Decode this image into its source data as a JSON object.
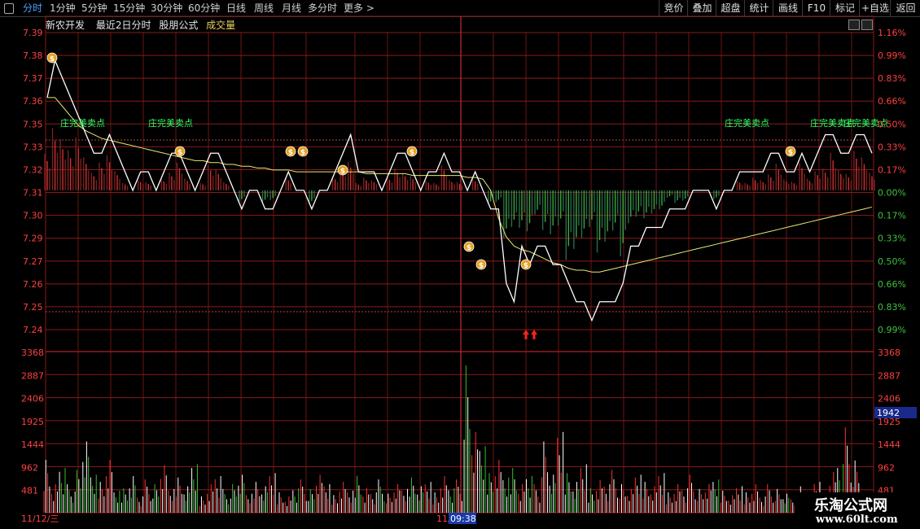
{
  "toolbar": {
    "tabs": [
      {
        "label": "分时",
        "active": true
      },
      {
        "label": "1分钟"
      },
      {
        "label": "5分钟"
      },
      {
        "label": "15分钟"
      },
      {
        "label": "30分钟"
      },
      {
        "label": "60分钟"
      },
      {
        "label": "日线"
      },
      {
        "label": "周线"
      },
      {
        "label": "月线"
      },
      {
        "label": "多分时"
      },
      {
        "label": "更多 >"
      }
    ],
    "right_buttons": [
      "竞价",
      "叠加",
      "超盘",
      "统计",
      "画线",
      "F10",
      "标记",
      "+自选",
      "返回"
    ]
  },
  "info": {
    "stock_name": "新农开发",
    "period": "最近2日分时",
    "formula": "股朋公式",
    "indicator": "成交量"
  },
  "price_axis": {
    "left": [
      "7.39",
      "7.38",
      "7.37",
      "7.36",
      "7.35",
      "7.33",
      "7.32",
      "7.31",
      "7.30",
      "7.29",
      "7.27",
      "7.26",
      "7.25",
      "7.24"
    ],
    "right": [
      "1.16%",
      "0.99%",
      "0.83%",
      "0.66%",
      "0.50%",
      "0.33%",
      "0.17%",
      "0.00%",
      "0.17%",
      "0.33%",
      "0.50%",
      "0.66%",
      "0.83%",
      "0.99%"
    ]
  },
  "volume_axis": {
    "labels": [
      "3368",
      "2887",
      "2406",
      "1925",
      "1444",
      "962",
      "481"
    ],
    "current_tag": "1942"
  },
  "time_axis": {
    "day1": "11/12/三",
    "day2": "11/",
    "cursor_time": "09:38"
  },
  "signals": {
    "sell_text": "庄完美卖点",
    "sell_abbrev": "庄"
  },
  "watermark": {
    "line1": "乐淘公式网",
    "line2": "www.60lt.com"
  },
  "colors": {
    "price_line": "#ffffff",
    "avg_line": "#e8e870",
    "up": "#ff3333",
    "down": "#33cc33",
    "grid": "#8b1a1a",
    "axis_text": "#ff4040",
    "vol_label": "#ff4040",
    "signal": "#33ff66"
  },
  "chart_data": {
    "type": "line",
    "title": "",
    "prev_close": 7.31,
    "ylim_price": [
      7.235,
      7.395
    ],
    "ylim_volume": [
      0,
      3368
    ],
    "price": [
      7.36,
      7.38,
      7.37,
      7.36,
      7.35,
      7.34,
      7.33,
      7.33,
      7.34,
      7.33,
      7.32,
      7.31,
      7.32,
      7.32,
      7.31,
      7.32,
      7.33,
      7.33,
      7.32,
      7.31,
      7.32,
      7.33,
      7.33,
      7.32,
      7.31,
      7.3,
      7.31,
      7.31,
      7.3,
      7.3,
      7.31,
      7.32,
      7.31,
      7.31,
      7.3,
      7.31,
      7.31,
      7.32,
      7.33,
      7.34,
      7.32,
      7.32,
      7.32,
      7.31,
      7.32,
      7.33,
      7.33,
      7.32,
      7.31,
      7.32,
      7.32,
      7.33,
      7.32,
      7.32,
      7.31,
      7.32,
      7.31,
      7.3,
      7.3,
      7.26,
      7.25,
      7.28,
      7.27,
      7.28,
      7.28,
      7.27,
      7.27,
      7.26,
      7.25,
      7.25,
      7.24,
      7.25,
      7.25,
      7.25,
      7.26,
      7.28,
      7.28,
      7.29,
      7.29,
      7.29,
      7.3,
      7.3,
      7.3,
      7.31,
      7.31,
      7.31,
      7.3,
      7.31,
      7.31,
      7.32,
      7.32,
      7.32,
      7.32,
      7.33,
      7.33,
      7.32,
      7.32,
      7.33,
      7.32,
      7.33,
      7.34,
      7.34,
      7.33,
      7.33,
      7.34,
      7.34,
      7.33
    ],
    "avg": [
      7.36,
      7.36,
      7.355,
      7.35,
      7.345,
      7.342,
      7.34,
      7.338,
      7.337,
      7.336,
      7.335,
      7.334,
      7.333,
      7.332,
      7.331,
      7.33,
      7.329,
      7.328,
      7.327,
      7.326,
      7.326,
      7.325,
      7.325,
      7.324,
      7.324,
      7.323,
      7.323,
      7.322,
      7.322,
      7.321,
      7.321,
      7.321,
      7.32,
      7.32,
      7.32,
      7.32,
      7.32,
      7.32,
      7.32,
      7.32,
      7.32,
      7.319,
      7.319,
      7.319,
      7.319,
      7.319,
      7.319,
      7.318,
      7.318,
      7.318,
      7.318,
      7.318,
      7.318,
      7.318,
      7.317,
      7.317,
      7.316,
      7.31,
      7.295,
      7.285,
      7.28,
      7.278,
      7.277,
      7.275,
      7.273,
      7.271,
      7.27,
      7.268,
      7.267,
      7.267,
      7.266,
      7.266,
      7.267,
      7.268,
      7.269,
      7.27,
      7.271,
      7.272,
      7.273,
      7.274,
      7.275,
      7.276,
      7.277,
      7.278,
      7.279,
      7.28,
      7.281,
      7.282,
      7.283,
      7.284,
      7.285,
      7.286,
      7.287,
      7.288,
      7.289,
      7.29,
      7.291,
      7.292,
      7.293,
      7.294,
      7.295,
      7.296,
      7.297,
      7.298,
      7.299,
      7.3,
      7.301
    ],
    "volume": [
      1300,
      700,
      1100,
      600,
      900,
      1500,
      800,
      700,
      1200,
      500,
      600,
      900,
      400,
      700,
      600,
      1000,
      500,
      800,
      600,
      1100,
      400,
      700,
      900,
      500,
      600,
      800,
      400,
      700,
      600,
      900,
      500,
      400,
      600,
      700,
      500,
      800,
      600,
      400,
      700,
      500,
      900,
      600,
      500,
      700,
      400,
      600,
      500,
      800,
      600,
      700,
      500,
      900,
      600,
      700,
      3100,
      1700,
      1400,
      900,
      1200,
      800,
      1100,
      700,
      900,
      600,
      1500,
      800,
      1700,
      900,
      700,
      1100,
      600,
      800,
      700,
      900,
      600,
      500,
      800,
      700,
      600,
      900,
      500,
      700,
      600,
      800,
      500,
      600,
      700,
      500,
      400,
      600,
      500,
      700,
      400,
      600,
      500,
      400,
      300,
      600,
      400,
      700,
      500,
      1000,
      1200,
      1800,
      1100
    ]
  }
}
